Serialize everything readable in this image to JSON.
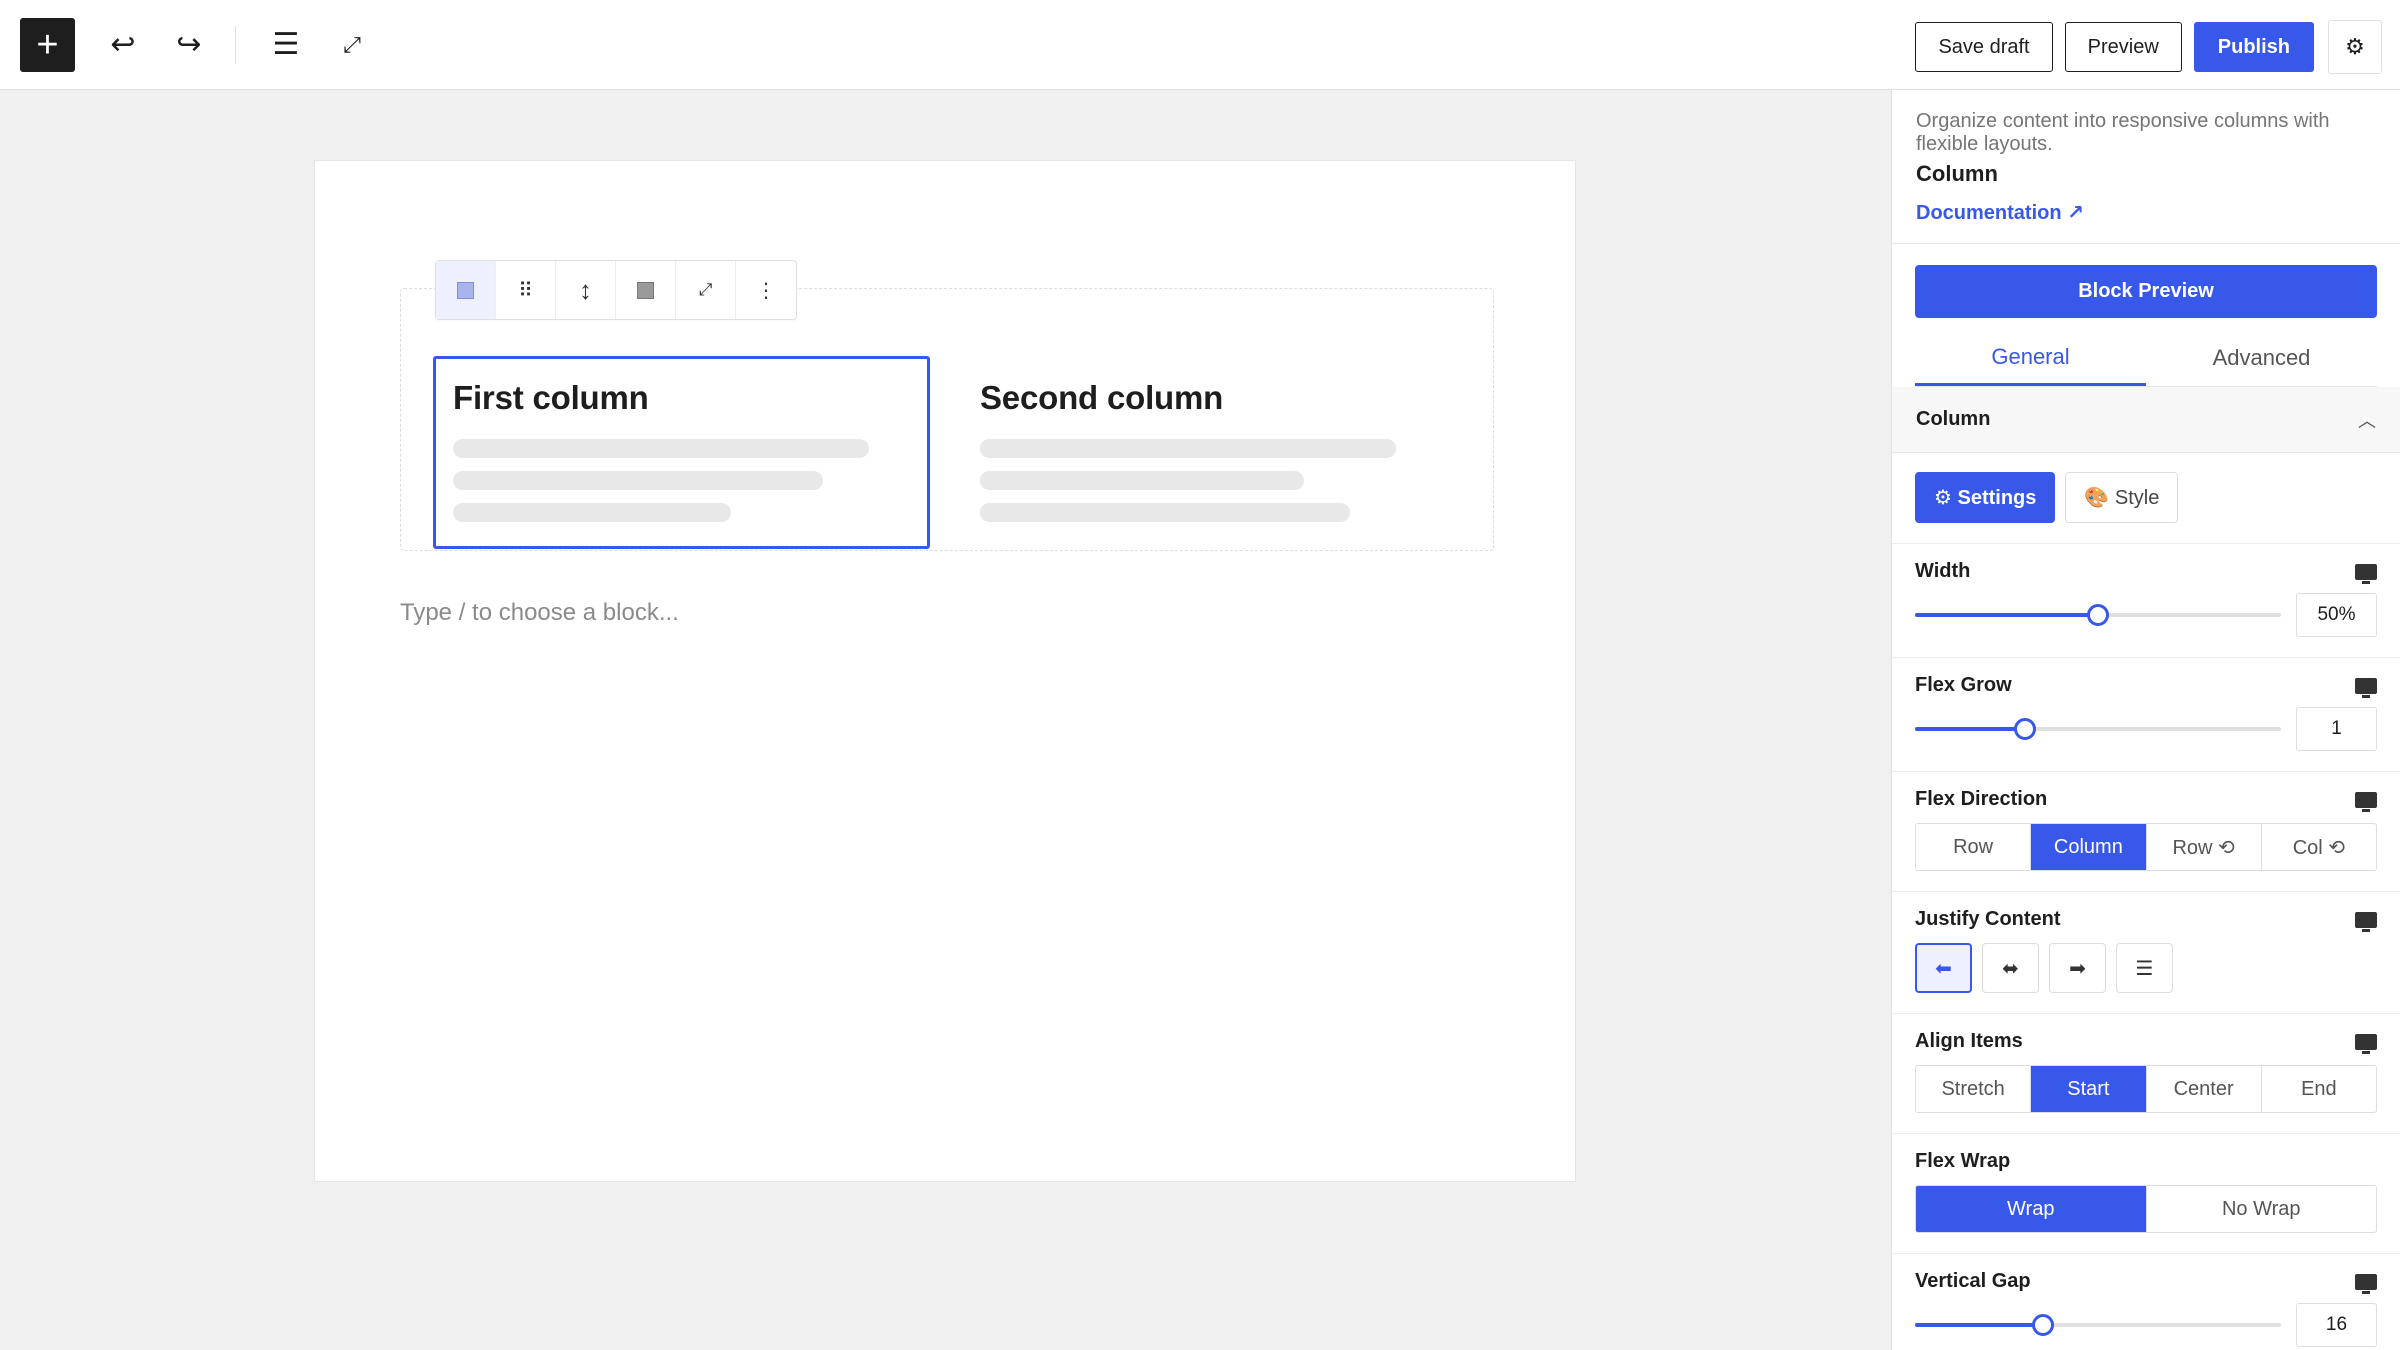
{
  "toolbar": {
    "add_icon": "+",
    "undo_icon": "↩",
    "redo_icon": "↪",
    "list_view_icon": "☰",
    "fullscreen_icon": "⤢",
    "save_draft": "Save draft",
    "preview": "Preview",
    "publish": "Publish",
    "settings_icon": "⚙"
  },
  "canvas": {
    "block_toolbar": {
      "drag_icon": "⠿",
      "move_icon": "↕",
      "expand_icon": "⤢",
      "more_icon": "⋮"
    },
    "columns": [
      {
        "heading": "First column",
        "selected": true
      },
      {
        "heading": "Second column",
        "selected": false
      }
    ],
    "placeholder": "Type / to choose a block..."
  },
  "sidebar": {
    "description": "Organize content into responsive columns with flexible layouts.",
    "block_name": "Column",
    "documentation": "Documentation ↗",
    "block_preview": "Block Preview",
    "tabs": [
      {
        "label": "General",
        "active": true
      },
      {
        "label": "Advanced",
        "active": false
      }
    ],
    "panel_title": "Column",
    "panel_chevron": "︿",
    "segments": [
      {
        "label": "⚙ Settings",
        "active": true
      },
      {
        "label": "🎨 Style",
        "active": false
      }
    ],
    "width": {
      "label": "Width",
      "value": "50%",
      "fraction": 0.5
    },
    "flex_grow": {
      "label": "Flex Grow",
      "value": "1",
      "fraction": 0.3
    },
    "flex_direction": {
      "label": "Flex Direction",
      "options": [
        "Row",
        "Column",
        "Row ⟲",
        "Col ⟲"
      ],
      "selected": "Column"
    },
    "justify_content": {
      "label": "Justify Content",
      "options": [
        "⬅",
        "⬌",
        "➡",
        "☰"
      ],
      "selected": 0
    },
    "align_items": {
      "label": "Align Items",
      "options": [
        "Stretch",
        "Start",
        "Center",
        "End"
      ],
      "selected": "Start"
    },
    "flex_wrap": {
      "label": "Flex Wrap",
      "options": [
        "Wrap",
        "No Wrap"
      ],
      "selected": "Wrap"
    },
    "vertical_gap": {
      "label": "Vertical Gap",
      "value": "16",
      "fraction": 0.35
    }
  },
  "colors": {
    "accent": "#3858e9",
    "text": "#1e1e1e",
    "canvas_bg": "#f0f0f0"
  }
}
